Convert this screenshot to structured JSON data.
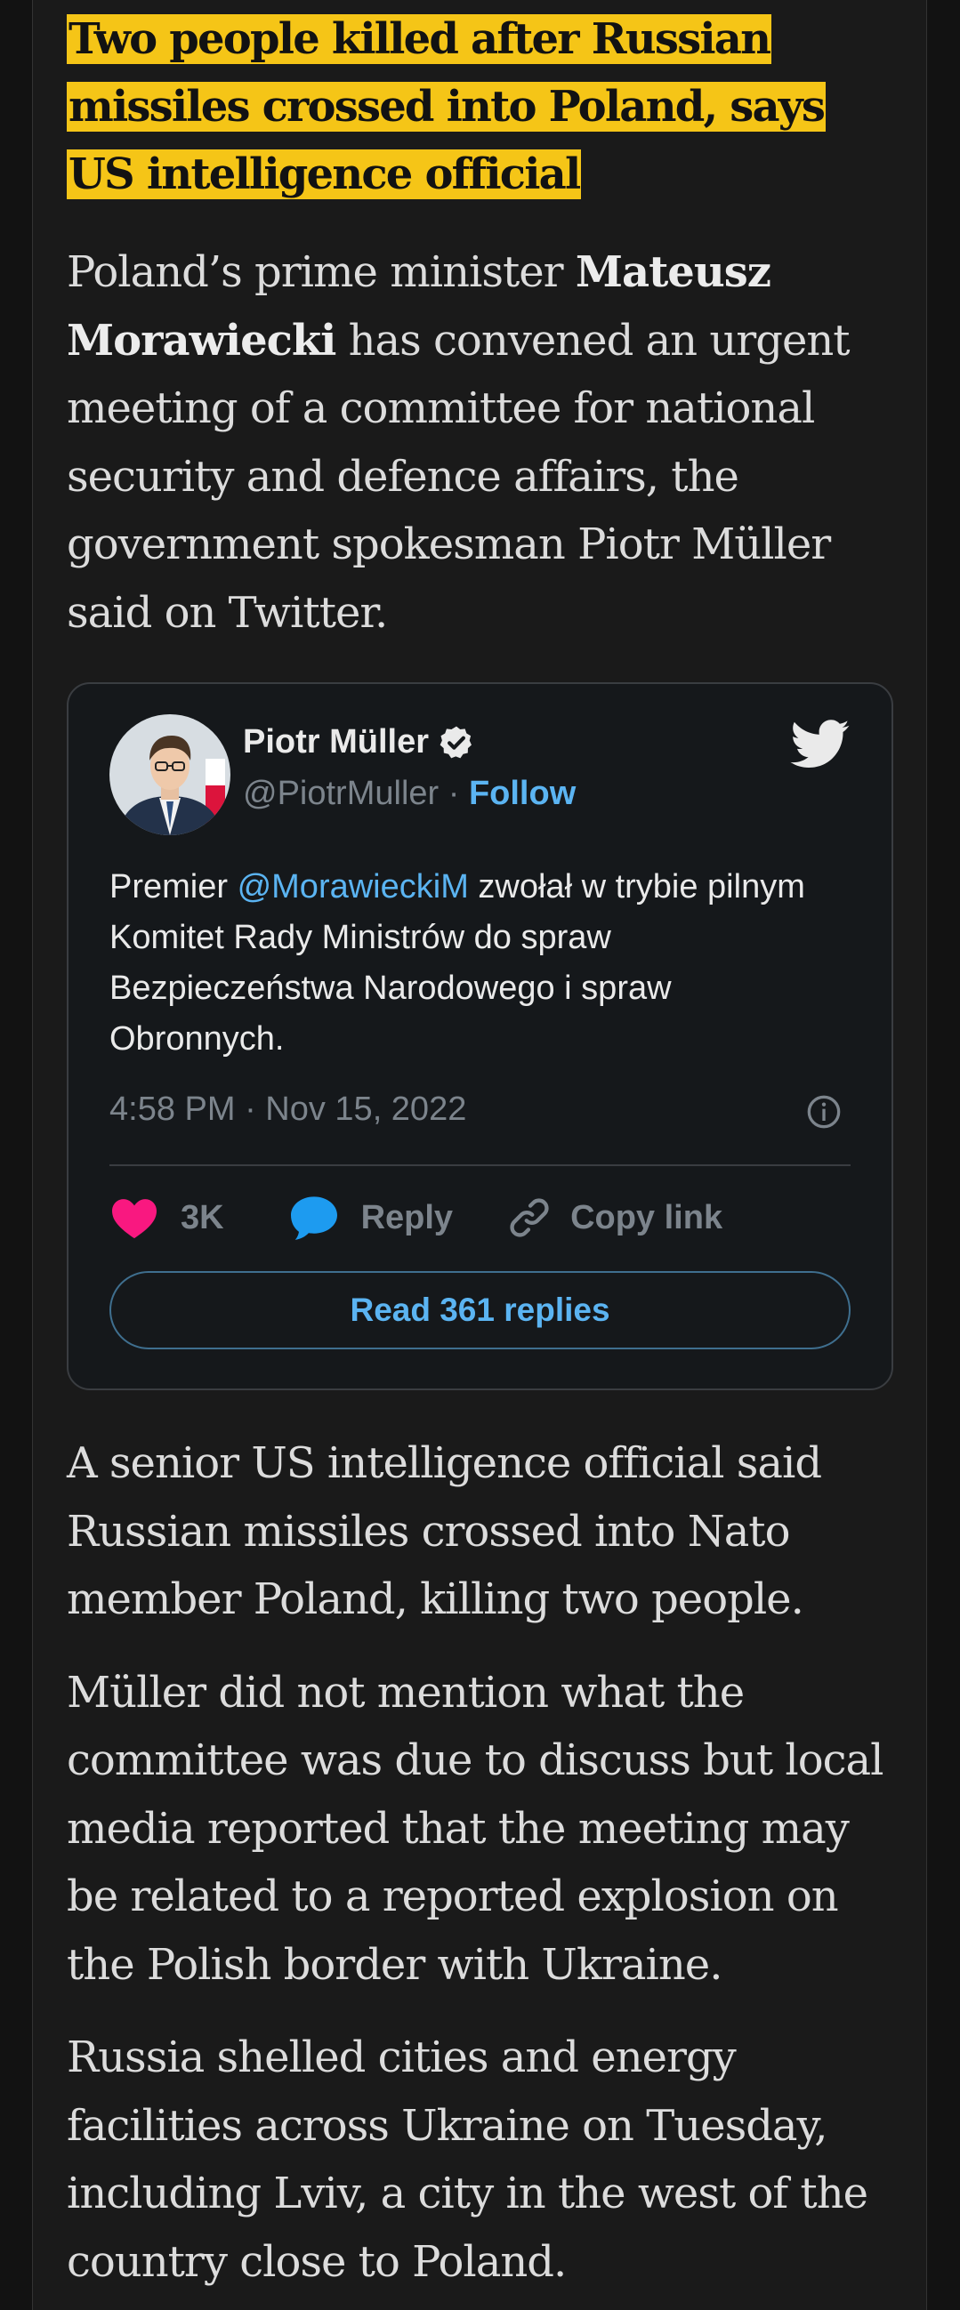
{
  "article": {
    "headline": "Two people killed after Russian missiles crossed into Poland, says US intelligence official",
    "intro": {
      "before": "Poland’s prime minister ",
      "bold": "Mateusz Morawiecki",
      "after": " has convened an urgent meeting of a committee for national security and defence affairs, the government spokesman Piotr Müller said on Twitter."
    },
    "paragraphs": [
      "A senior US intelligence official said Russian missiles crossed into Nato member Poland, killing two people.",
      "Müller did not mention what the committee was due to discuss but local media reported that the meeting may be related to a reported explosion on the Polish border with Ukraine.",
      "Russia shelled cities and energy facilities across Ukraine on Tuesday, including Lviv, a city in the west of the country close to Poland."
    ]
  },
  "tweet": {
    "author_name": "Piotr Müller",
    "handle": "@PiotrMuller",
    "separator": " · ",
    "follow_label": "Follow",
    "text_before": "Premier ",
    "mention": "@MorawieckiM",
    "text_after": " zwołał w trybie pilnym Komitet Rady Ministrów do spraw Bezpieczeństwa Narodowego i spraw Obronnych.",
    "timestamp": "4:58 PM · Nov 15, 2022",
    "like_count": "3K",
    "reply_label": "Reply",
    "copy_link_label": "Copy link",
    "read_replies_label": "Read 361 replies",
    "icons": {
      "verified": "verified-badge-icon",
      "brand": "twitter-bird-icon",
      "info": "info-icon",
      "like": "heart-icon",
      "reply": "speech-bubble-icon",
      "copy": "link-icon"
    },
    "colors": {
      "link": "#5bb4f2",
      "like": "#f91880",
      "reply_icon": "#1d9bf0"
    }
  },
  "colors": {
    "headline_highlight": "#f5c517",
    "background": "#1a1a1a"
  }
}
